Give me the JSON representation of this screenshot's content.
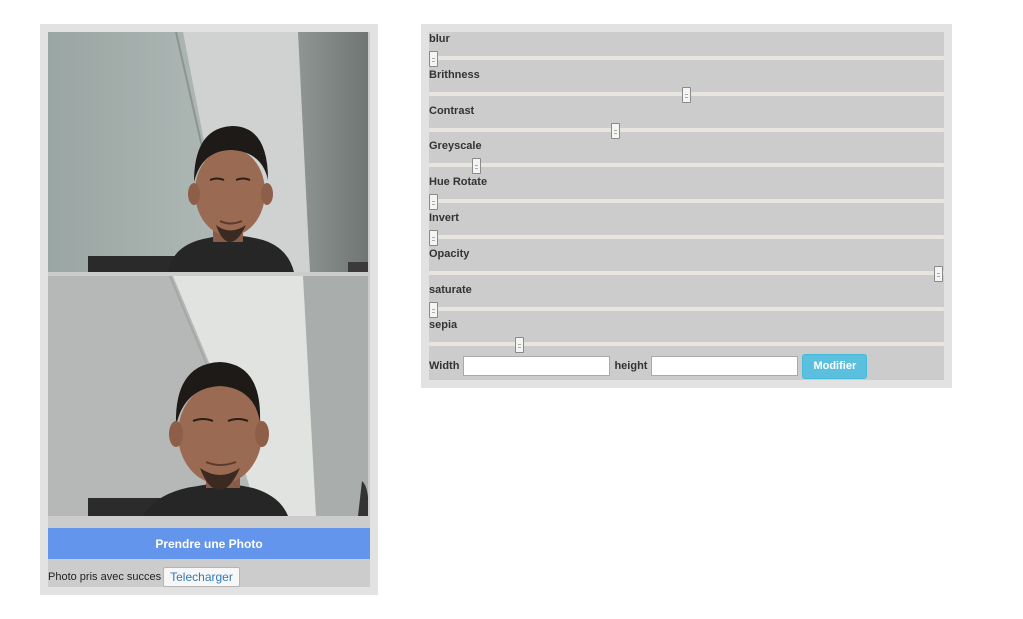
{
  "camera": {
    "capture_label": "Prendre une Photo",
    "status_text": "Photo pris avec succes",
    "download_label": "Telecharger"
  },
  "filters": [
    {
      "label": "blur",
      "value": 0.0
    },
    {
      "label": "Brithness",
      "value": 0.5
    },
    {
      "label": "Contrast",
      "value": 0.36
    },
    {
      "label": "Greyscale",
      "value": 0.085
    },
    {
      "label": "Hue Rotate",
      "value": 0.0
    },
    {
      "label": "Invert",
      "value": 0.0
    },
    {
      "label": "Opacity",
      "value": 1.0
    },
    {
      "label": "saturate",
      "value": 0.0
    },
    {
      "label": "sepia",
      "value": 0.17
    }
  ],
  "size": {
    "width_label": "Width",
    "width_value": "",
    "height_label": "height",
    "height_value": "",
    "apply_label": "Modifier"
  },
  "colors": {
    "capture_button": "#6495ed",
    "apply_button": "#5bc0de",
    "panel": "#cccccc"
  }
}
